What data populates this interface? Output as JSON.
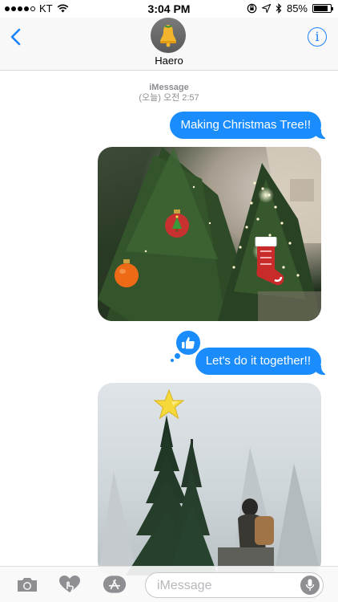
{
  "status_bar": {
    "carrier": "KT",
    "time": "3:04 PM",
    "battery_percent": "85%",
    "battery_level": 0.85,
    "signal_bars_filled": 4,
    "signal_bars_total": 5
  },
  "nav": {
    "contact_name": "Haero",
    "info_label": "i"
  },
  "thread": {
    "service": "iMessage",
    "timestamp": "(오늘) 오전 2:57",
    "messages": [
      {
        "type": "text",
        "text": "Making Christmas Tree!!"
      },
      {
        "type": "photo",
        "stickers": [
          "ornament-sticker",
          "orange-ornament-sticker",
          "stocking-sticker"
        ]
      },
      {
        "type": "text",
        "text": "Let's do it together!!",
        "tapback": "thumbs-up-icon"
      },
      {
        "type": "photo",
        "stickers": [
          "star-sticker"
        ]
      }
    ]
  },
  "input_bar": {
    "placeholder": "iMessage"
  },
  "colors": {
    "accent": "#1a82fb",
    "bubble": "#1a8cfb"
  }
}
